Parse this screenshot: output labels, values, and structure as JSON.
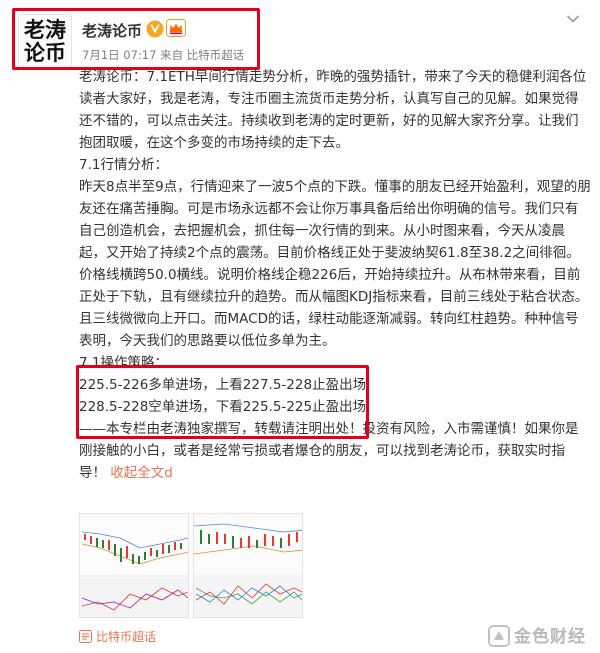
{
  "author": {
    "avatar_lines": [
      "老涛",
      "论币"
    ],
    "name": "老涛论币"
  },
  "post_meta": {
    "time": "7月1日 07:17",
    "source_prefix": "来自",
    "source": "比特币超话"
  },
  "content": {
    "intro": "老涛论币：7.1ETH早间行情走势分析，昨晚的强势插针，带来了今天的稳健利润各位读者大家好，我是老涛，专注币圈主流货币走势分析，认真写自己的见解。如果觉得还不错的，可以点击关注。持续收到老涛的定时更新，好的见解大家齐分享。让我们抱团取暖，在这个多变的市场持续的走下去。",
    "analysis_title": "7.1行情分析：",
    "analysis": "昨天8点半至9点，行情迎来了一波5个点的下跌。懂事的朋友已经开始盈利，观望的朋友还在痛苦捶胸。可是市场永远都不会让你万事具备后给出你明确的信号。我们只有自己创造机会，去把握机会，抓住每一次行情的到来。从小时图来看，今天从凌晨起，又开始了持续2个点的震荡。目前价格线正处于斐波纳契61.8至38.2之间徘徊。价格线横跨50.0横线。说明价格线企稳226后，开始持续拉升。从布林带来看，目前正处于下轨，且有继续拉升的趋势。而从幅图KDJ指标来看，目前三线处于粘合状态。且三线微微向上开口。而MACD的话，绿柱动能逐渐减弱。转向红柱趋势。种种信号表明，今天我们的思路要以低位多单为主。",
    "strategy_title": "7.1操作策略：",
    "strategy_long": "225.5-226多单进场，上看227.5-228止盈出场",
    "strategy_short": "228.5-228空单进场，下看225.5-225止盈出场",
    "outro": "——本专栏由老涛独家撰写，转载请注明出处！投资有风险，入市需谨慎！如果你是刚接触的小白，或者是经常亏损或者爆仓的朋友，可以找到老涛论币，获取实时指导！",
    "expand_label": "收起全文",
    "expand_suffix": "d"
  },
  "topic": {
    "label": "比特币超话"
  },
  "watermark": {
    "text": "金色财经"
  },
  "colors": {
    "highlight_border": "#e3001b",
    "link": "#eb7350",
    "verified": "#f5a623"
  },
  "icons": [
    "verified-icon",
    "crown-icon",
    "chevron-down-icon",
    "topic-icon",
    "watermark-logo"
  ]
}
